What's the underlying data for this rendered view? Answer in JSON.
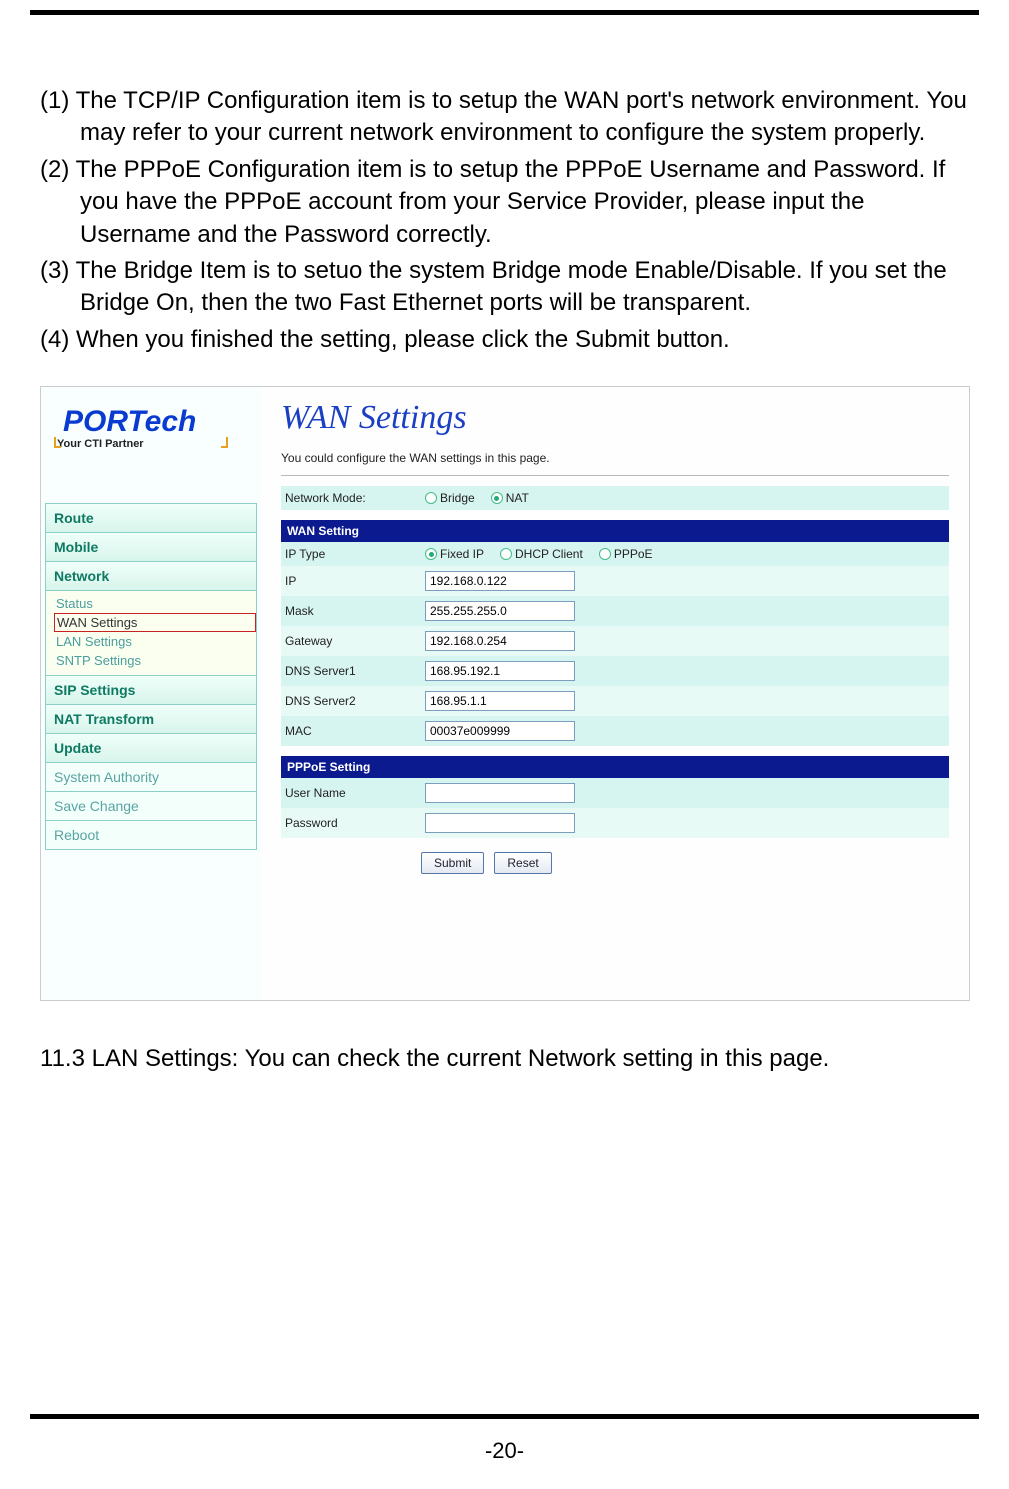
{
  "instructions": {
    "i1": "(1) The TCP/IP Configuration item is to setup the WAN port's network environment. You may refer to your current network environment to configure the system properly.",
    "i2": "(2) The PPPoE Configuration item is to setup the PPPoE Username and Password. If you have the PPPoE account from your Service Provider, please input the Username and the Password correctly.",
    "i3": "(3) The Bridge Item is to setuo the system Bridge mode Enable/Disable. If you set the Bridge On, then the two Fast Ethernet ports will be transparent.",
    "i4": "(4) When you finished the setting, please click the Submit button."
  },
  "logo": {
    "brand": "PORTech",
    "tagline": "Your CTI Partner"
  },
  "sidebar": {
    "route": "Route",
    "mobile": "Mobile",
    "network": "Network",
    "network_items": {
      "status": "Status",
      "wan": "WAN Settings",
      "lan": "LAN Settings",
      "sntp": "SNTP Settings"
    },
    "sip": "SIP Settings",
    "nat": "NAT Transform",
    "update": "Update",
    "sysauth": "System Authority",
    "save": "Save Change",
    "reboot": "Reboot"
  },
  "main": {
    "title": "WAN Settings",
    "desc": "You could configure the WAN settings in this page.",
    "network_mode_label": "Network Mode:",
    "network_mode": {
      "bridge": "Bridge",
      "nat": "NAT"
    },
    "wan_head": "WAN Setting",
    "iptype_label": "IP Type",
    "iptype": {
      "fixed": "Fixed IP",
      "dhcp": "DHCP Client",
      "pppoe": "PPPoE"
    },
    "fields": {
      "ip_label": "IP",
      "ip_value": "192.168.0.122",
      "mask_label": "Mask",
      "mask_value": "255.255.255.0",
      "gw_label": "Gateway",
      "gw_value": "192.168.0.254",
      "dns1_label": "DNS Server1",
      "dns1_value": "168.95.192.1",
      "dns2_label": "DNS Server2",
      "dns2_value": "168.95.1.1",
      "mac_label": "MAC",
      "mac_value": "00037e009999"
    },
    "pppoe_head": "PPPoE Setting",
    "pppoe": {
      "user_label": "User Name",
      "pass_label": "Password"
    },
    "submit": "Submit",
    "reset": "Reset"
  },
  "section_after": "11.3 LAN Settings: You can check the current Network setting in this page.",
  "page_number": "-20-"
}
